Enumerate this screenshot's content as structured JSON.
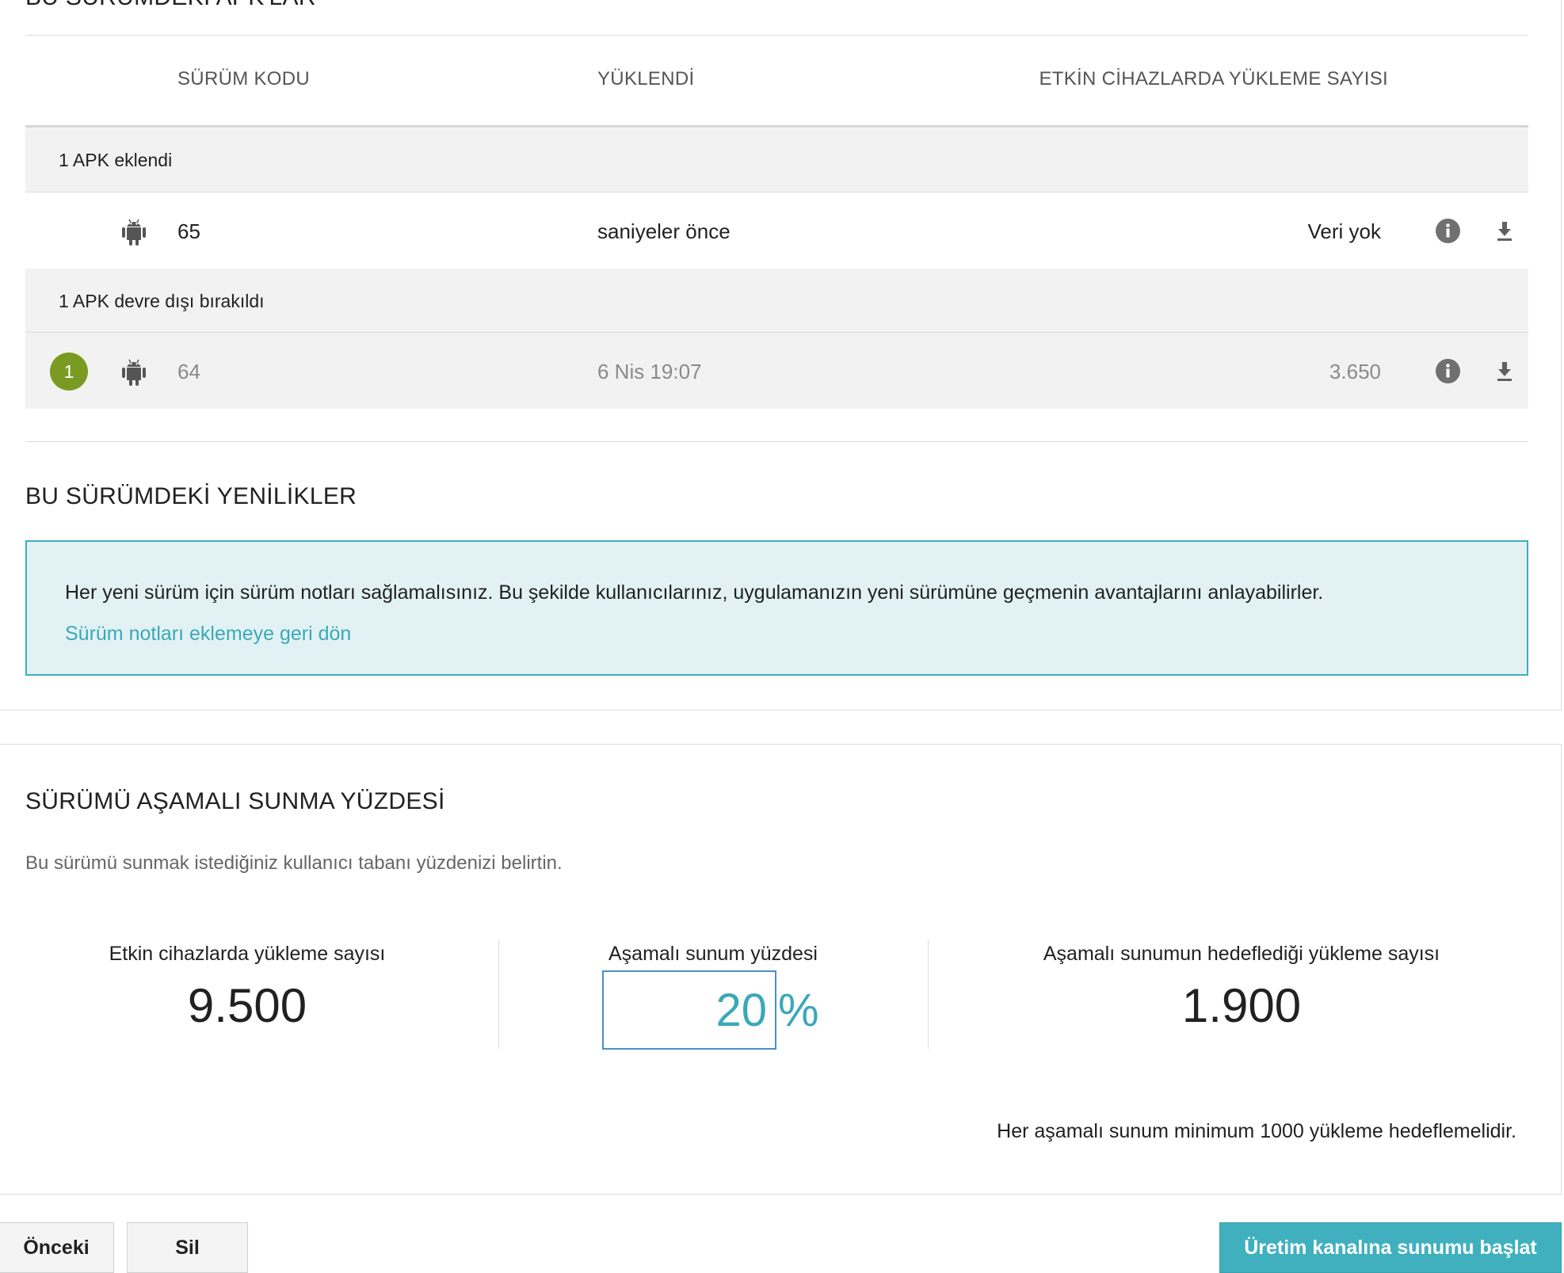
{
  "apks_section": {
    "title": "BU SÜRÜMDEKİ APK'LAR",
    "columns": {
      "version_code": "SÜRÜM KODU",
      "uploaded": "YÜKLENDİ",
      "installs": "ETKİN CİHAZLARDA YÜKLEME SAYISI"
    },
    "groups": [
      {
        "label": "1 APK eklendi",
        "rows": [
          {
            "version_code": "65",
            "uploaded": "saniyeler önce",
            "installs": "Veri yok",
            "badge": ""
          }
        ]
      },
      {
        "label": "1 APK devre dışı bırakıldı",
        "rows": [
          {
            "version_code": "64",
            "uploaded": "6 Nis 19:07",
            "installs": "3.650",
            "badge": "1"
          }
        ]
      }
    ],
    "icons": {
      "platform": "android-icon",
      "info": "info-icon",
      "download": "download-icon"
    }
  },
  "whats_new": {
    "title": "BU SÜRÜMDEKİ YENİLİKLER",
    "notice_text": "Her yeni sürüm için sürüm notları sağlamalısınız. Bu şekilde kullanıcılarınız, uygulamanızın yeni sürümüne geçmenin avantajlarını anlayabilirler.",
    "notice_link": "Sürüm notları eklemeye geri dön"
  },
  "staged_rollout": {
    "title": "SÜRÜMÜ AŞAMALI SUNMA YÜZDESİ",
    "description": "Bu sürümü sunmak istediğiniz kullanıcı tabanı yüzdenizi belirtin.",
    "active_installs_label": "Etkin cihazlarda yükleme sayısı",
    "active_installs_value": "9.500",
    "percentage_label": "Aşamalı sunum yüzdesi",
    "percentage_value": "20",
    "percent_sign": "%",
    "target_label": "Aşamalı sunumun hedeflediği yükleme sayısı",
    "target_value": "1.900",
    "minimum_note": "Her aşamalı sunum minimum 1000 yükleme hedeflemelidir."
  },
  "footer": {
    "prev_label": "Önceki",
    "delete_label": "Sil",
    "start_label": "Üretim kanalına sunumu başlat"
  },
  "colors": {
    "accent": "#40b0bf",
    "link": "#3ba8b8",
    "notice_bg": "#e2f2f4",
    "badge": "#7a9b21"
  }
}
